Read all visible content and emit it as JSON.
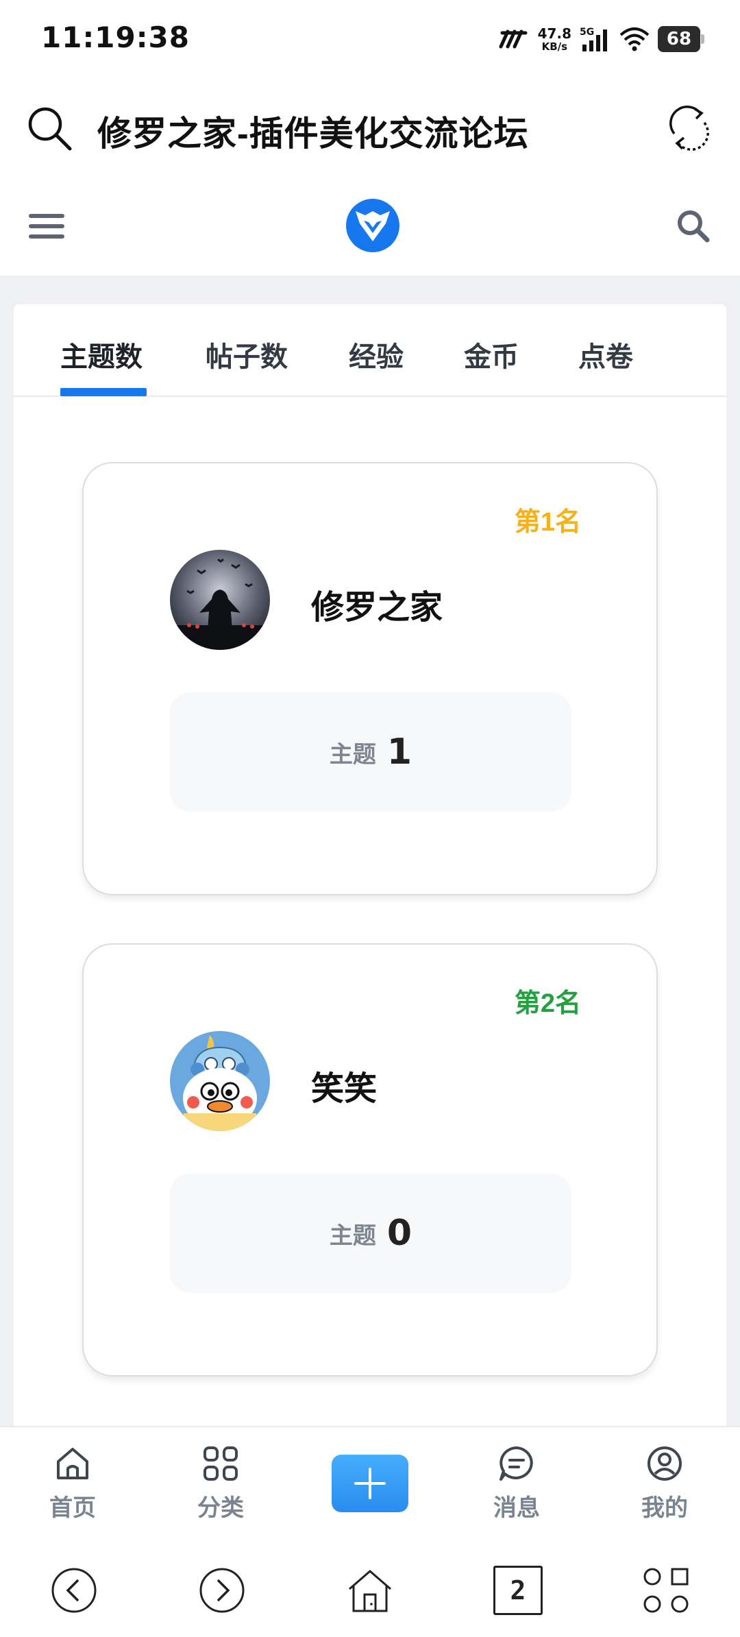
{
  "status_bar": {
    "time": "11:19:38",
    "network_speed_value": "47.8",
    "network_speed_unit": "KB/s",
    "network_type": "5G",
    "battery": "68"
  },
  "title_bar": {
    "title": "修罗之家-插件美化交流论坛"
  },
  "tabs": [
    {
      "label": "主题数",
      "active": true
    },
    {
      "label": "帖子数",
      "active": false
    },
    {
      "label": "经验",
      "active": false
    },
    {
      "label": "金币",
      "active": false
    },
    {
      "label": "点卷",
      "active": false
    }
  ],
  "ranking": [
    {
      "rank_label": "第1名",
      "name": "修罗之家",
      "stat_label": "主题",
      "stat_value": "1",
      "rank_color": "#f5b11c"
    },
    {
      "rank_label": "第2名",
      "name": "笑笑",
      "stat_label": "主题",
      "stat_value": "0",
      "rank_color": "#23a140"
    }
  ],
  "bottom_nav": [
    {
      "label": "首页",
      "icon": "home-icon"
    },
    {
      "label": "分类",
      "icon": "grid-icon"
    },
    {
      "label": "",
      "icon": "plus-icon"
    },
    {
      "label": "消息",
      "icon": "message-icon"
    },
    {
      "label": "我的",
      "icon": "profile-icon"
    }
  ],
  "system_nav": {
    "tab_count": "2"
  },
  "colors": {
    "accent": "#1777ee",
    "add_button": "#3a9ef8"
  }
}
